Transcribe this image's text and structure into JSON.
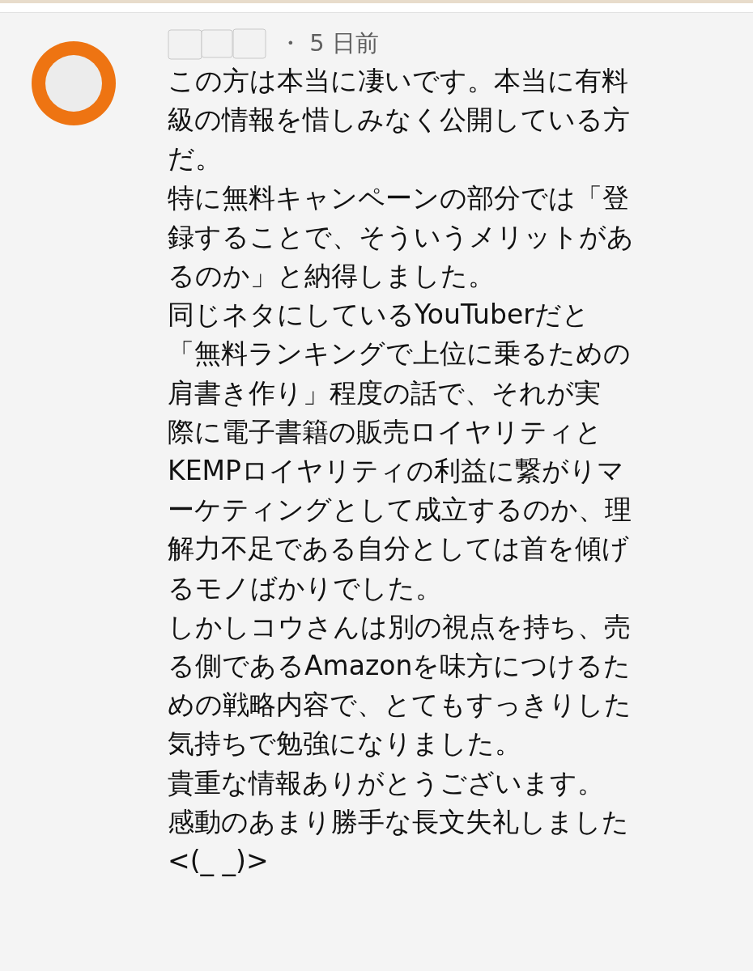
{
  "comment": {
    "meta": "・ 5 日前",
    "lines": [
      "この方は本当に凄いです。本当に有料",
      "級の情報を惜しみなく公開している方",
      "だ。",
      "特に無料キャンペーンの部分では「登",
      "録することで、そういうメリットがあ",
      "るのか」と納得しました。",
      "同じネタにしているYouTuberだと",
      "「無料ランキングで上位に乗るための",
      "肩書き作り」程度の話で、それが実",
      "際に電子書籍の販売ロイヤリティと",
      "KEMPロイヤリティの利益に繋がりマ",
      "ーケティングとして成立するのか、理",
      "解力不足である自分としては首を傾げ",
      "るモノばかりでした。",
      "しかしコウさんは別の視点を持ち、売",
      "る側であるAmazonを味方につけるた",
      "めの戦略内容で、とてもすっきりした",
      "気持ちで勉強になりました。",
      "貴重な情報ありがとうございます。",
      "感動のあまり勝手な長文失礼しました",
      "<(_ _)>"
    ]
  }
}
